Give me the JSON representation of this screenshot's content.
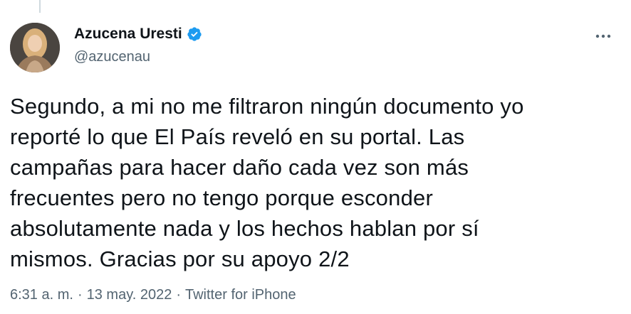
{
  "author": {
    "name": "Azucena Uresti",
    "handle": "@azucenau",
    "verified": true
  },
  "tweet": {
    "text": "Segundo, a mi no me filtraron ningún documento yo\nreporté lo que El País reveló en su portal. Las\ncampañas para hacer daño cada vez son más\nfrecuentes pero no tengo porque esconder\nabsolutamente nada y los hechos hablan por sí\nmismos. Gracias por su apoyo 2/2"
  },
  "meta": {
    "time": "6:31 a. m.",
    "separator": "·",
    "date": "13 may. 2022",
    "separator2": "·",
    "source": "Twitter for iPhone"
  },
  "icons": {
    "verified": "verified-badge-icon",
    "more": "more-options-icon"
  },
  "colors": {
    "verified": "#1d9bf0",
    "secondary_text": "#536471",
    "primary_text": "#0f1419"
  }
}
